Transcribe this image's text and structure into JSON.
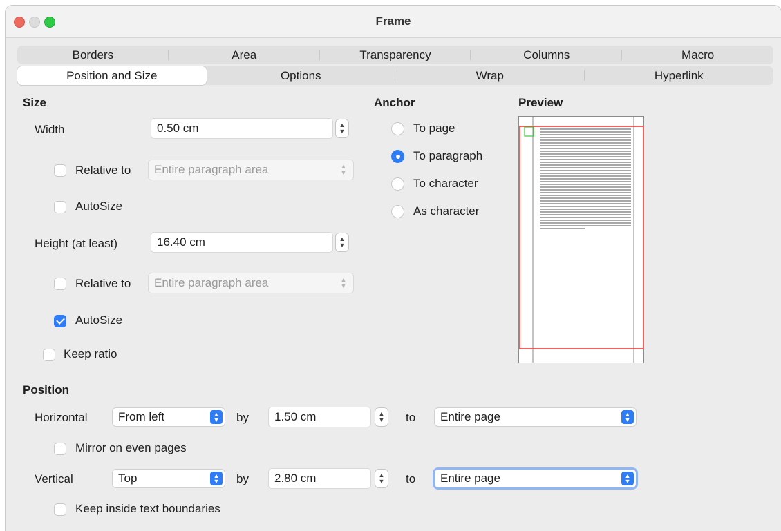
{
  "window": {
    "title": "Frame"
  },
  "tabs": {
    "row1": [
      "Borders",
      "Area",
      "Transparency",
      "Columns",
      "Macro"
    ],
    "row2": [
      "Position and Size",
      "Options",
      "Wrap",
      "Hyperlink"
    ],
    "active": "Position and Size"
  },
  "size": {
    "title": "Size",
    "width_label": "Width",
    "width_value": "0.50 cm",
    "relative_to_label": "Relative to",
    "width_relative_value": "Entire paragraph area",
    "width_relative_checked": false,
    "autosize_label": "AutoSize",
    "width_autosize_checked": false,
    "height_label": "Height (at least)",
    "height_value": "16.40 cm",
    "height_relative_value": "Entire paragraph area",
    "height_relative_checked": false,
    "height_autosize_checked": true,
    "keep_ratio_label": "Keep ratio",
    "keep_ratio_checked": false
  },
  "anchor": {
    "title": "Anchor",
    "options": [
      "To page",
      "To paragraph",
      "To character",
      "As character"
    ],
    "selected": "To paragraph"
  },
  "preview": {
    "title": "Preview"
  },
  "position": {
    "title": "Position",
    "horizontal_label": "Horizontal",
    "horizontal_value": "From left",
    "by_label": "by",
    "horizontal_by": "1.50 cm",
    "to_label": "to",
    "horizontal_to": "Entire page",
    "mirror_label": "Mirror on even pages",
    "mirror_checked": false,
    "vertical_label": "Vertical",
    "vertical_value": "Top",
    "vertical_by": "2.80 cm",
    "vertical_to": "Entire page",
    "keep_inside_label": "Keep inside text boundaries",
    "keep_inside_checked": false
  },
  "colors": {
    "accent": "#2e7cf6",
    "frame_outline": "#e8302c",
    "anchor_marker": "#3ccc3c"
  }
}
